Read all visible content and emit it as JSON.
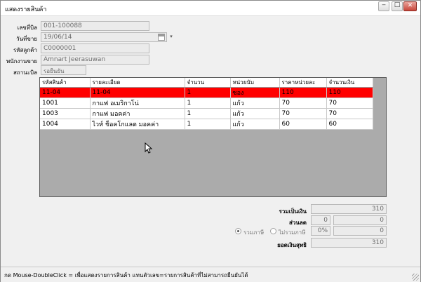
{
  "window": {
    "title": "แสดงรายสินค้า"
  },
  "form": {
    "bill_no": {
      "label": "เลขที่บิล",
      "value": "001-100088"
    },
    "sale_date": {
      "label": "วันที่ขาย",
      "value": "19/06/14"
    },
    "customer_code": {
      "label": "รหัสลูกค้า",
      "value": "C0000001"
    },
    "salesperson": {
      "label": "พนักงานขาย",
      "value": "Amnart Jeerasuwan"
    },
    "bill_status": {
      "label": "สถานะบิล",
      "value": "รอยืนยัน"
    }
  },
  "grid": {
    "columns": [
      "รหัสสินค้า",
      "รายละเอียด",
      "จำนวน",
      "หน่วยนับ",
      "ราคาหน่วยละ",
      "จำนวนเงิน"
    ],
    "rows": [
      [
        "11-04",
        "11-04",
        "1",
        "ซอง",
        "110",
        "110"
      ],
      [
        "1001",
        "กาแฟ อเมริกาโน่",
        "1",
        "แก้ว",
        "70",
        "70"
      ],
      [
        "1003",
        "กาแฟ มอคค่า",
        "1",
        "แก้ว",
        "70",
        "70"
      ],
      [
        "1004",
        "ไวท์ ช็อคโกแลต มอคค่า",
        "1",
        "แก้ว",
        "60",
        "60"
      ]
    ],
    "selected_row": 0
  },
  "totals": {
    "subtotal": {
      "label": "รวมเป็นเงิน",
      "value": "310"
    },
    "discount": {
      "label": "ส่วนลด",
      "value_a": "0",
      "value_b": "0"
    },
    "vat": {
      "option_incl": "รวมภาษี",
      "option_excl": "ไม่รวมภาษี",
      "rate": "0%",
      "amount": "0"
    },
    "net": {
      "label": "ยอดเงินสุทธิ",
      "value": "310"
    }
  },
  "status_bar": {
    "text": "กด Mouse-DoubleClick = เพื่อแสดงรายการสินค้า แทนตัวเลข=รายการสินค้าที่ไม่สามารถยืนยันได้"
  },
  "colors": {
    "selected_row": "#ff0000",
    "grid_background": "#ababab"
  }
}
